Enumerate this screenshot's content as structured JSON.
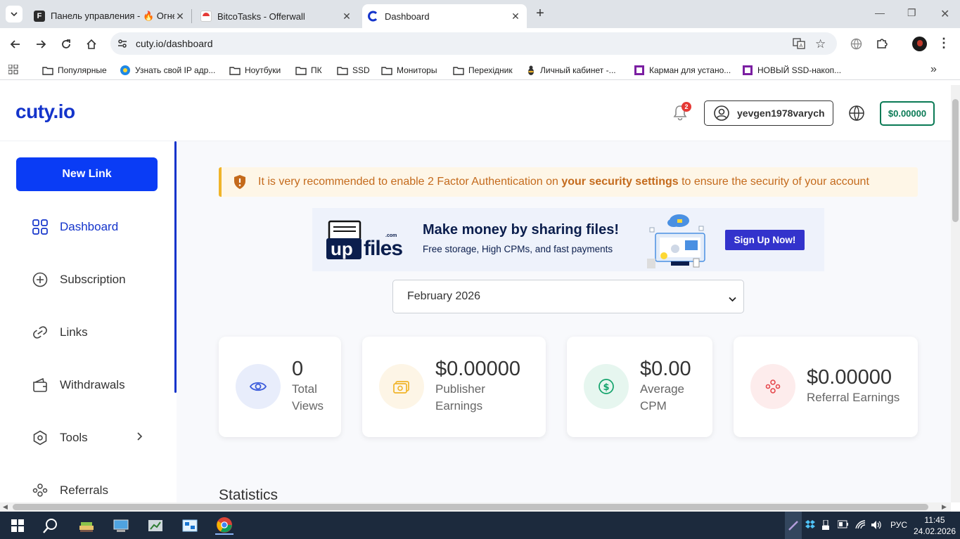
{
  "browser": {
    "tabs": [
      {
        "title": "Панель управления - 🔥 Огнеу",
        "favicon": "f-logo-icon",
        "active": false
      },
      {
        "title": "BitcoTasks - Offerwall",
        "favicon": "bitcotasks-icon",
        "active": false
      },
      {
        "title": "Dashboard",
        "favicon": "cuty-icon",
        "active": true
      }
    ],
    "url": "cuty.io/dashboard",
    "bookmarks": [
      {
        "label": "Популярные",
        "icon": "folder-icon"
      },
      {
        "label": "Узнать свой IP адр...",
        "icon": "ip-icon"
      },
      {
        "label": "Ноутбуки",
        "icon": "folder-icon"
      },
      {
        "label": "ПК",
        "icon": "folder-icon"
      },
      {
        "label": "SSD",
        "icon": "folder-icon"
      },
      {
        "label": "Мониторы",
        "icon": "folder-icon"
      },
      {
        "label": "Перехідник",
        "icon": "folder-icon"
      },
      {
        "label": "Личный кабинет -...",
        "icon": "bee-icon"
      },
      {
        "label": "Карман для устано...",
        "icon": "purple-square-icon"
      },
      {
        "label": "НОВЫЙ SSD-накоп...",
        "icon": "purple-square-icon"
      }
    ]
  },
  "header": {
    "logo": "cuty.io",
    "notifications_count": "2",
    "username": "yevgen1978varych",
    "balance": "$0.00000"
  },
  "sidebar": {
    "new_link_label": "New Link",
    "items": [
      {
        "label": "Dashboard",
        "icon": "grid-icon",
        "active": true
      },
      {
        "label": "Subscription",
        "icon": "plus-circle-icon",
        "active": false
      },
      {
        "label": "Links",
        "icon": "link-icon",
        "active": false
      },
      {
        "label": "Withdrawals",
        "icon": "wallet-icon",
        "active": false
      },
      {
        "label": "Tools",
        "icon": "hexagon-icon",
        "active": false
      },
      {
        "label": "Referrals",
        "icon": "users-icon",
        "active": false
      }
    ]
  },
  "alert": {
    "prefix": "It is very recommended to enable 2 Factor Authentication on ",
    "link": "your security settings",
    "suffix": " to ensure the security of your account"
  },
  "banner": {
    "brand_up": "up",
    "brand_files": "files",
    "brand_com": ".com",
    "headline": "Make money by sharing files!",
    "subline": "Free storage, High CPMs, and fast payments",
    "cta": "Sign Up Now!"
  },
  "month_select": {
    "value": "February 2026"
  },
  "stats_cards": [
    {
      "value": "0",
      "label_lines": [
        "Total",
        "Views"
      ],
      "icon": "eye-icon",
      "color": "#3b5bdb",
      "bg": "#e8edfb"
    },
    {
      "value": "$0.00000",
      "label_lines": [
        "Publisher",
        "Earnings"
      ],
      "icon": "money-icon",
      "color": "#f0b429",
      "bg": "#fdf5e6"
    },
    {
      "value": "$0.00",
      "label_lines": [
        "Average",
        "CPM"
      ],
      "icon": "dollar-circle-icon",
      "color": "#12a36b",
      "bg": "#e6f6ef"
    },
    {
      "value": "$0.00000",
      "label_lines": [
        "Referral Earnings"
      ],
      "icon": "referral-icon",
      "color": "#e5484d",
      "bg": "#fdecec"
    }
  ],
  "statistics_title": "Statistics",
  "taskbar": {
    "lang": "РУС",
    "time": "11:45",
    "date": "24.02.2026"
  }
}
